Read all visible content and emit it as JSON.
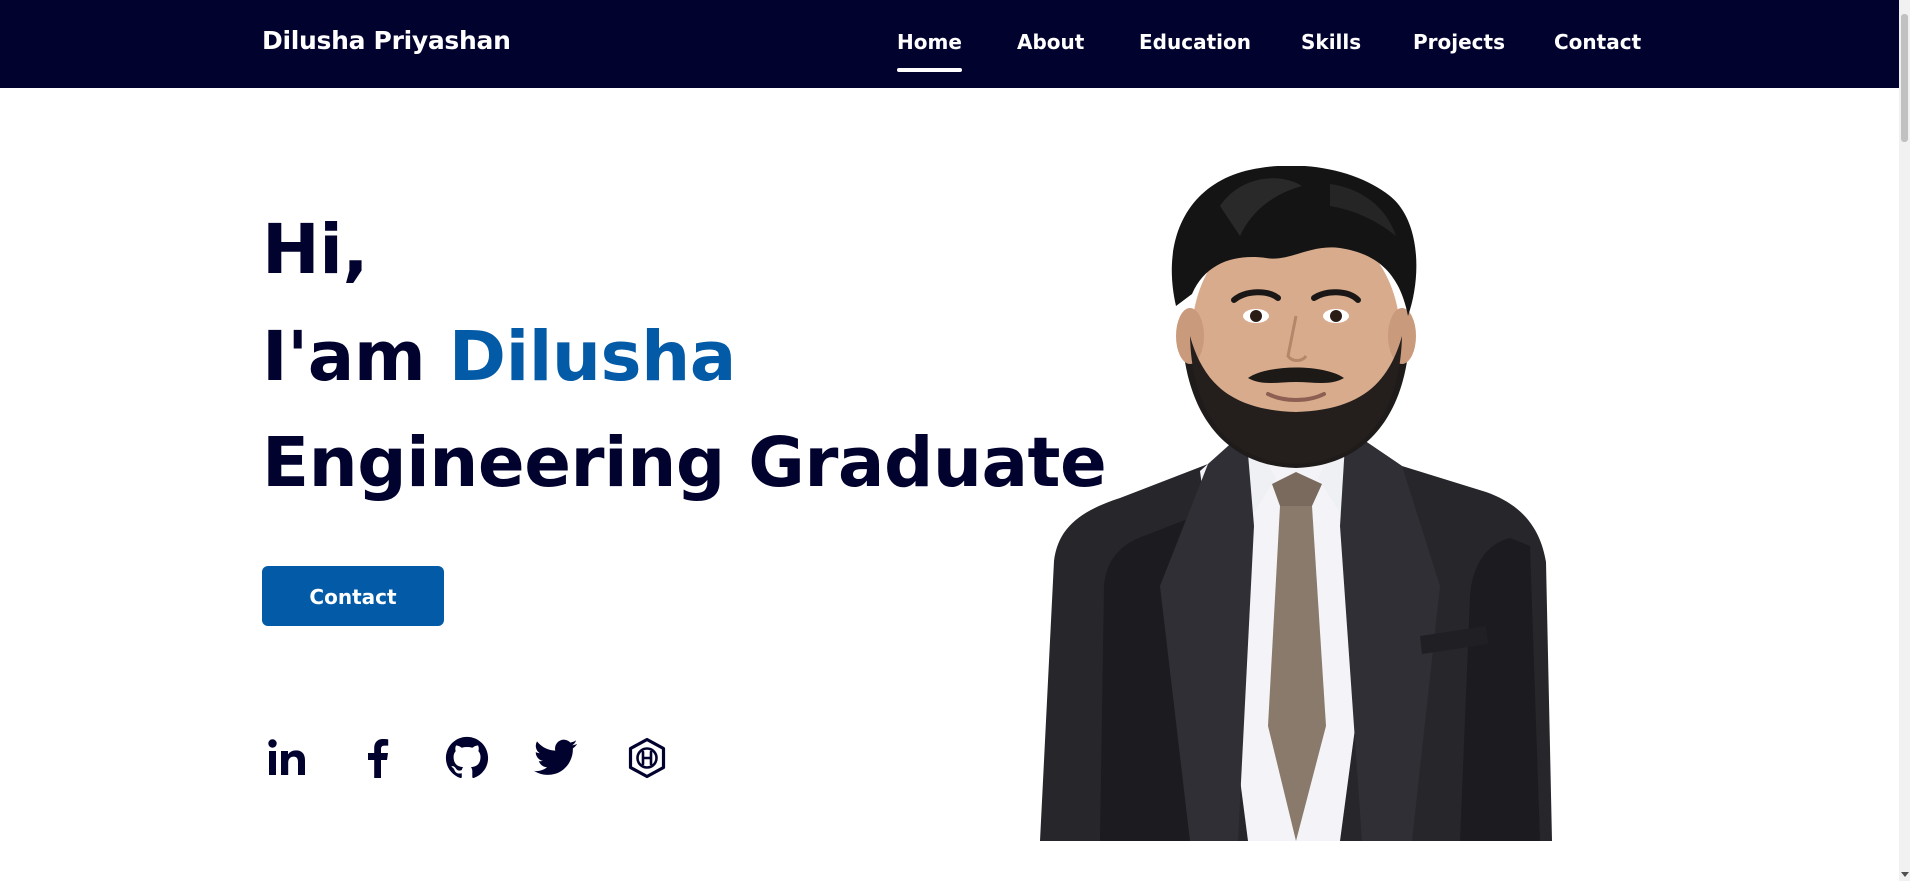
{
  "header": {
    "brand": "Dilusha Priyashan",
    "nav": [
      {
        "label": "Home",
        "active": true
      },
      {
        "label": "About",
        "active": false
      },
      {
        "label": "Education",
        "active": false
      },
      {
        "label": "Skills",
        "active": false
      },
      {
        "label": "Projects",
        "active": false
      },
      {
        "label": "Contact",
        "active": false
      }
    ]
  },
  "hero": {
    "greeting": "Hi,",
    "intro_prefix": "I'am",
    "intro_name": "Dilusha",
    "role": "Engineering Graduate",
    "contact_button": "Contact"
  },
  "social": [
    {
      "icon": "linkedin-icon"
    },
    {
      "icon": "facebook-icon"
    },
    {
      "icon": "github-icon"
    },
    {
      "icon": "twitter-icon"
    },
    {
      "icon": "hashnode-icon"
    }
  ],
  "colors": {
    "header_bg": "#02022f",
    "text_dark": "#02022f",
    "accent": "#035aa6",
    "white": "#ffffff"
  }
}
